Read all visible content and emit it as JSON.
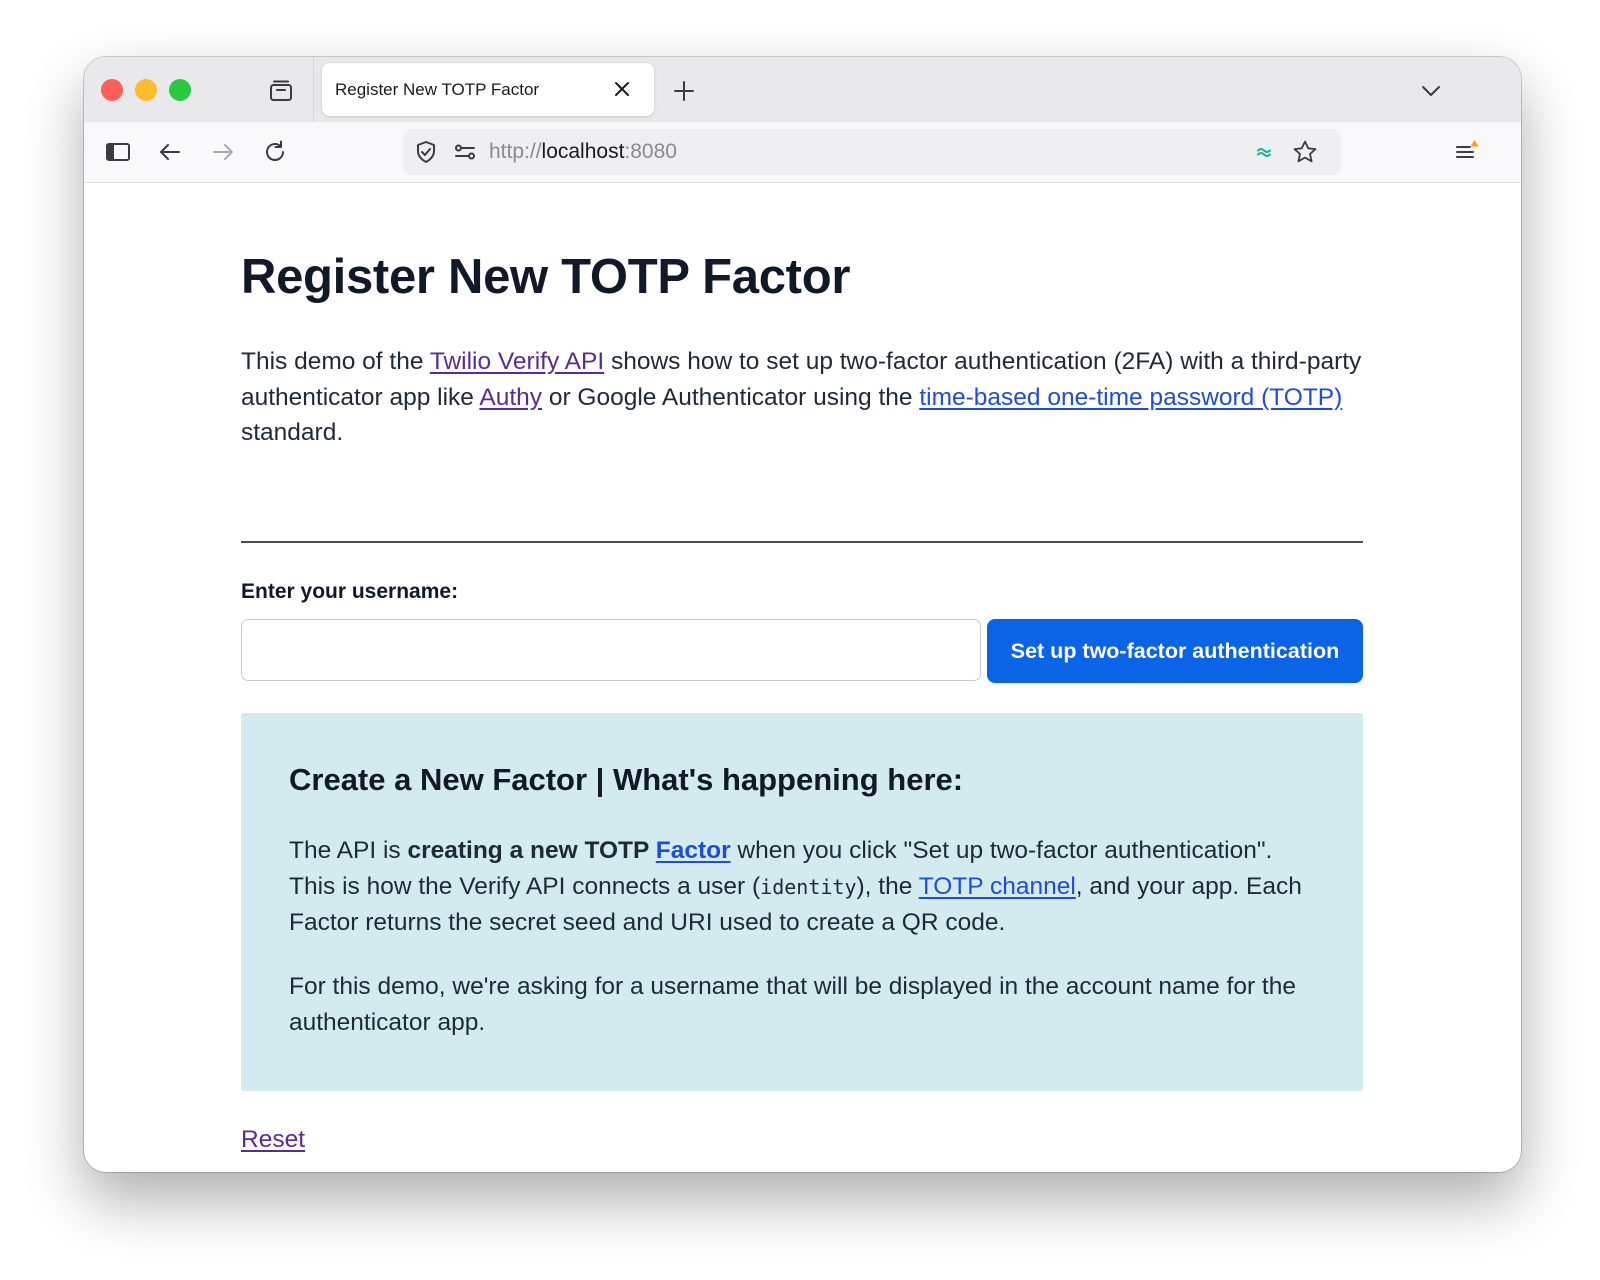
{
  "browser": {
    "tab_title": "Register New TOTP Factor",
    "url_scheme": "http://",
    "url_host": "localhost",
    "url_port": ":8080"
  },
  "page": {
    "title": "Register New TOTP Factor",
    "intro": {
      "t1": "This demo of the ",
      "link1": "Twilio Verify API",
      "t2": " shows how to set up two-factor authentication (2FA) with a third-party authenticator app like ",
      "link2": "Authy",
      "t3": " or Google Authenticator using the ",
      "link3": "time-based one-time password (TOTP)",
      "t4": " standard."
    },
    "form": {
      "label": "Enter your username:",
      "input_value": "",
      "input_placeholder": "",
      "button": "Set up two-factor authentication"
    },
    "info": {
      "heading": "Create a New Factor | What's happening here:",
      "p1": {
        "t1": "The API is ",
        "bold": "creating a new TOTP ",
        "link_factor": "Factor",
        "t2": " when you click \"Set up two-factor authentication\". This is how the Verify API connects a user (",
        "code": "identity",
        "t3": "), the ",
        "link_channel": "TOTP channel",
        "t4": ", and your app. Each Factor returns the secret seed and URI used to create a QR code."
      },
      "p2": "For this demo, we're asking for a username that will be displayed in the account name for the authenticator app."
    },
    "reset": "Reset"
  },
  "colors": {
    "primary_button": "#0b63e5",
    "info_background": "#d3eaee",
    "link": "#1d4ed8",
    "visited_link": "#5b2c8f"
  }
}
